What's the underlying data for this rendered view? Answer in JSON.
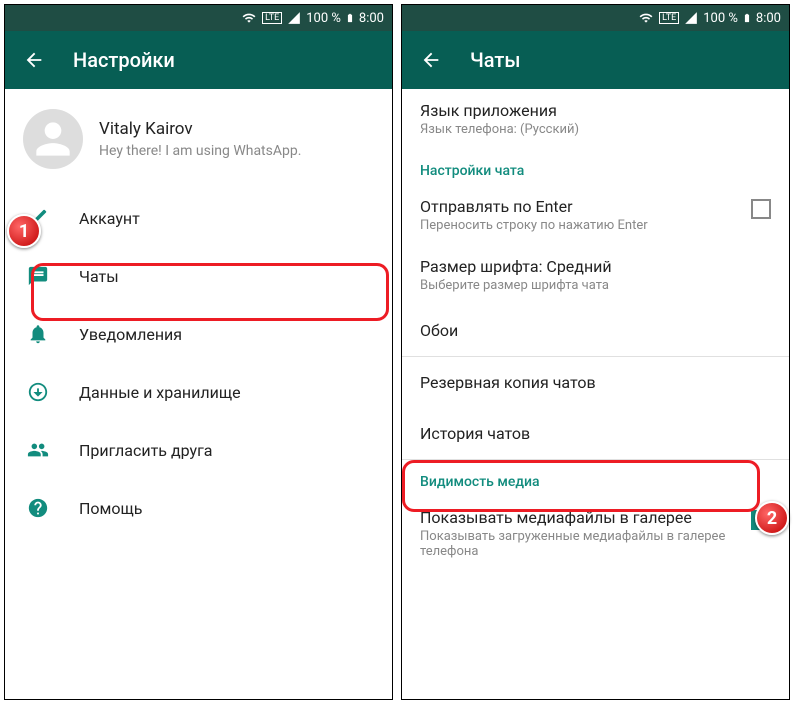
{
  "statusbar": {
    "battery": "100 %",
    "time": "8:00",
    "lte": "LTE"
  },
  "left": {
    "title": "Настройки",
    "profile": {
      "name": "Vitaly Kairov",
      "status": "Hey there! I am using WhatsApp."
    },
    "menu": {
      "account": "Аккаунт",
      "chats": "Чаты",
      "notifications": "Уведомления",
      "data": "Данные и хранилище",
      "invite": "Пригласить друга",
      "help": "Помощь"
    }
  },
  "right": {
    "title": "Чаты",
    "lang": {
      "primary": "Язык приложения",
      "secondary": "Язык телефона: (Русский)"
    },
    "sec_chat": "Настройки чата",
    "enter": {
      "primary": "Отправлять по Enter",
      "secondary": "Переносить строку по нажатию Enter"
    },
    "font": {
      "primary": "Размер шрифта: Средний",
      "secondary": "Выберите размер шрифта чата"
    },
    "wall": "Обои",
    "backup": "Резервная копия чатов",
    "history": "История чатов",
    "sec_media": "Видимость медиа",
    "media": {
      "primary": "Показывать медиафайлы в галерее",
      "secondary": "Показывать загруженные медиафайлы в галерее телефона"
    }
  },
  "markers": {
    "m1": "1",
    "m2": "2"
  }
}
